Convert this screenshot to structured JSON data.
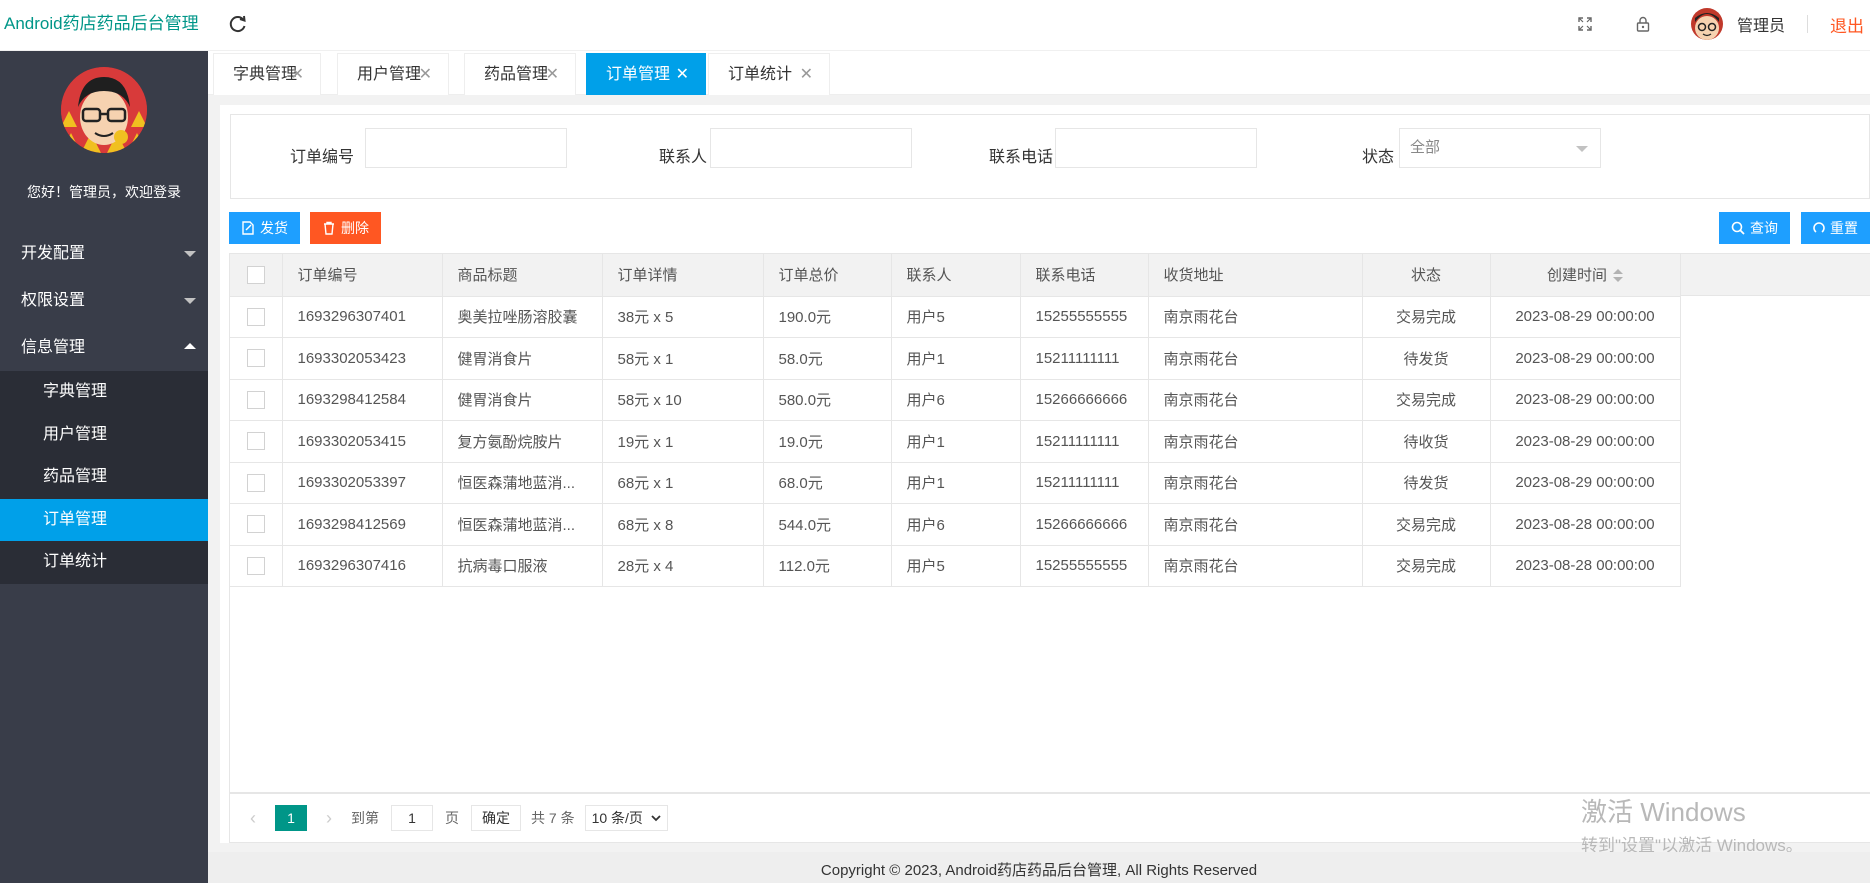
{
  "app": {
    "title": "Android药店药品后台管理"
  },
  "header": {
    "user_name": "管理员",
    "logout_label": "退出"
  },
  "sidebar": {
    "welcome": "您好！管理员，欢迎登录",
    "groups": [
      {
        "label": "开发配置"
      },
      {
        "label": "权限设置"
      },
      {
        "label": "信息管理"
      }
    ],
    "sub_items": [
      {
        "label": "字典管理"
      },
      {
        "label": "用户管理"
      },
      {
        "label": "药品管理"
      },
      {
        "label": "订单管理"
      },
      {
        "label": "订单统计"
      }
    ]
  },
  "tabs": [
    {
      "label": "字典管理"
    },
    {
      "label": "用户管理"
    },
    {
      "label": "药品管理"
    },
    {
      "label": "订单管理"
    },
    {
      "label": "订单统计"
    }
  ],
  "search": {
    "order_no_label": "订单编号",
    "contact_label": "联系人",
    "phone_label": "联系电话",
    "status_label": "状态",
    "status_value": "全部"
  },
  "toolbar": {
    "ship_label": "发货",
    "delete_label": "删除",
    "query_label": "查询",
    "reset_label": "重置"
  },
  "table": {
    "columns": [
      "订单编号",
      "商品标题",
      "订单详情",
      "订单总价",
      "联系人",
      "联系电话",
      "收货地址",
      "状态",
      "创建时间"
    ],
    "rows": [
      [
        "1693296307401",
        "奥美拉唑肠溶胶囊",
        "38元 x 5",
        "190.0元",
        "用户5",
        "15255555555",
        "南京雨花台",
        "交易完成",
        "2023-08-29 00:00:00"
      ],
      [
        "1693302053423",
        "健胃消食片",
        "58元 x 1",
        "58.0元",
        "用户1",
        "15211111111",
        "南京雨花台",
        "待发货",
        "2023-08-29 00:00:00"
      ],
      [
        "1693298412584",
        "健胃消食片",
        "58元 x 10",
        "580.0元",
        "用户6",
        "15266666666",
        "南京雨花台",
        "交易完成",
        "2023-08-29 00:00:00"
      ],
      [
        "1693302053415",
        "复方氨酚烷胺片",
        "19元 x 1",
        "19.0元",
        "用户1",
        "15211111111",
        "南京雨花台",
        "待收货",
        "2023-08-29 00:00:00"
      ],
      [
        "1693302053397",
        "恒医森蒲地蓝消...",
        "68元 x 1",
        "68.0元",
        "用户1",
        "15211111111",
        "南京雨花台",
        "待发货",
        "2023-08-29 00:00:00"
      ],
      [
        "1693298412569",
        "恒医森蒲地蓝消...",
        "68元 x 8",
        "544.0元",
        "用户6",
        "15266666666",
        "南京雨花台",
        "交易完成",
        "2023-08-28 00:00:00"
      ],
      [
        "1693296307416",
        "抗病毒口服液",
        "28元 x 4",
        "112.0元",
        "用户5",
        "15255555555",
        "南京雨花台",
        "交易完成",
        "2023-08-28 00:00:00"
      ]
    ]
  },
  "pagination": {
    "current_page": "1",
    "goto_prefix": "到第",
    "goto_value": "1",
    "goto_suffix": "页",
    "confirm_label": "确定",
    "total_label": "共 7 条",
    "page_size_label": "10 条/页"
  },
  "watermark": {
    "line1": "激活 Windows",
    "line2": "转到\"设置\"以激活 Windows。"
  },
  "footer": {
    "copyright": "Copyright © 2023, Android药店药品后台管理, All Rights Reserved"
  },
  "colors": {
    "accent": "#00a0e9",
    "sidebar_bg": "#393d49",
    "logo": "#009688",
    "danger": "#ff5722",
    "primary_btn": "#1e9fff"
  }
}
